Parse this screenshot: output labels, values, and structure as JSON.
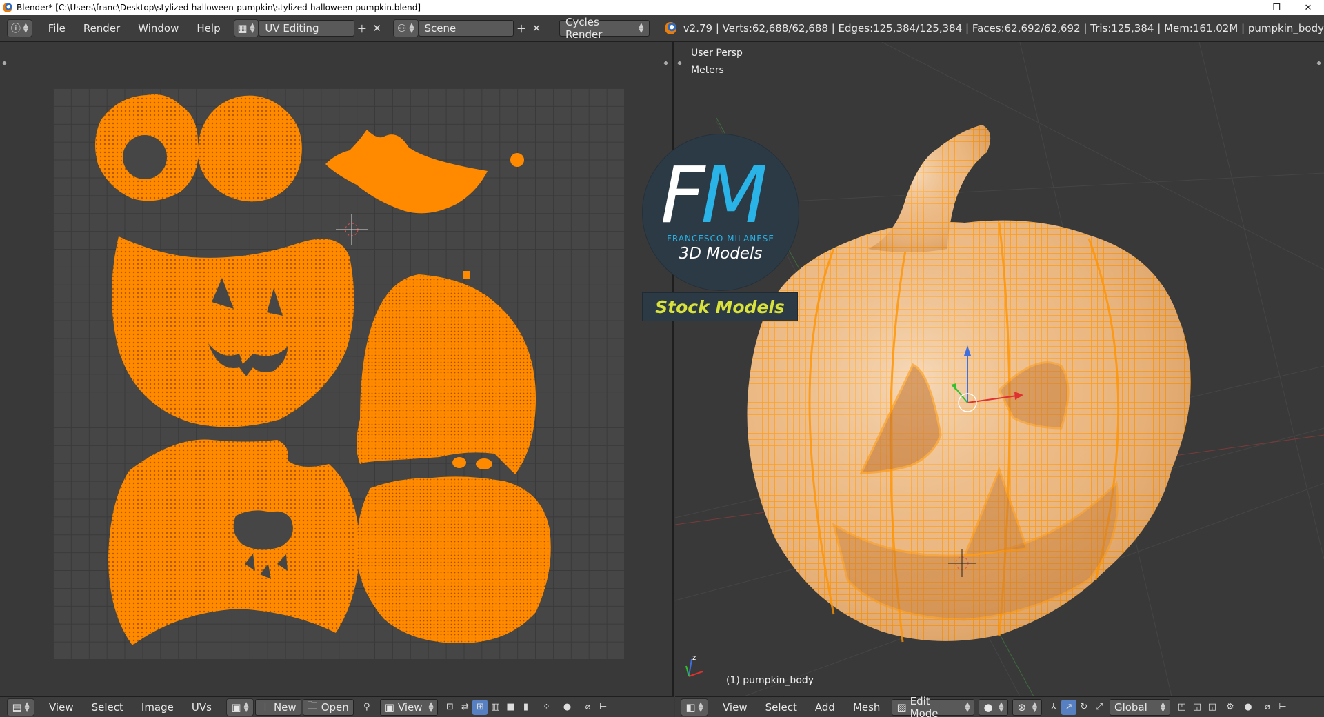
{
  "window": {
    "title": "Blender* [C:\\Users\\franc\\Desktop\\stylized-halloween-pumpkin\\stylized-halloween-pumpkin.blend]"
  },
  "topbar": {
    "menus": [
      "File",
      "Render",
      "Window",
      "Help"
    ],
    "screen_layout": "UV Editing",
    "scene": "Scene",
    "render_engine": "Cycles Render",
    "stats": "v2.79 | Verts:62,688/62,688 | Edges:125,384/125,384 | Faces:62,692/62,692 | Tris:125,384 | Mem:161.02M | pumpkin_body"
  },
  "viewport": {
    "view_name": "User Persp",
    "units": "Meters",
    "object_label": "(1) pumpkin_body"
  },
  "watermark": {
    "letter_f": "F",
    "letter_m": "M",
    "name": "FRANCESCO MILANESE",
    "subtitle": "3D Models",
    "badge": "Stock Models"
  },
  "uv_header": {
    "menus": [
      "View",
      "Select",
      "Image",
      "UVs"
    ],
    "new_label": "New",
    "open_label": "Open",
    "view_label": "View"
  },
  "view3d_header": {
    "menus": [
      "View",
      "Select",
      "Add",
      "Mesh"
    ],
    "mode": "Edit Mode",
    "orientation": "Global"
  },
  "colors": {
    "uv_orange": "#ff8a00",
    "mesh_orange": "#ff9400",
    "header_bg": "#3d3d3d",
    "editor_bg": "#393939",
    "logo_blue": "#29b3e6",
    "badge_yellow": "#d8e23a"
  }
}
